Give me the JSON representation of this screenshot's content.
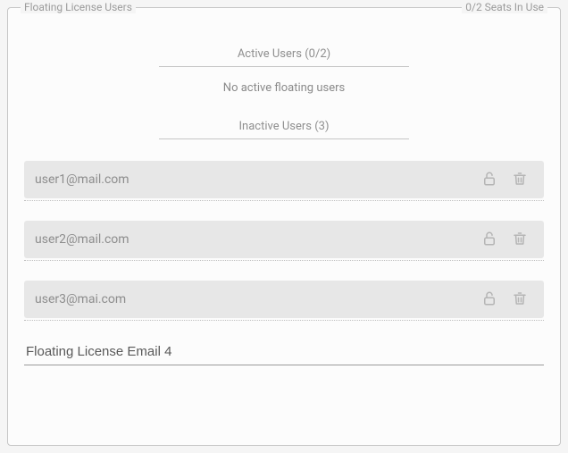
{
  "panel": {
    "title": "Floating License Users",
    "seats_status": "0/2 Seats In Use"
  },
  "active_users": {
    "heading": "Active Users (0/2)",
    "empty_text": "No active floating users"
  },
  "inactive_users": {
    "heading": "Inactive Users (3)",
    "items": [
      {
        "email": "user1@mail.com"
      },
      {
        "email": "user2@mail.com"
      },
      {
        "email": "user3@mai.com"
      }
    ]
  },
  "add_input": {
    "placeholder": "",
    "value": "Floating License Email 4"
  },
  "icons": {
    "unlock": "unlock-icon",
    "delete": "delete-icon"
  }
}
